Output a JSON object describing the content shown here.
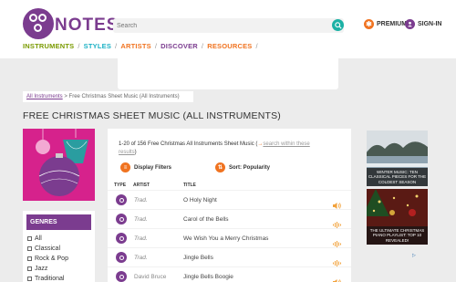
{
  "brand": {
    "name": "NOTES"
  },
  "search": {
    "placeholder": "Search"
  },
  "header": {
    "premium_label": "PREMIUM",
    "signin_label": "SIGN-IN"
  },
  "nav": {
    "items": [
      {
        "label": "INSTRUMENTS",
        "color": "#7a9a00"
      },
      {
        "label": "STYLES",
        "color": "#1cb1c5"
      },
      {
        "label": "ARTISTS",
        "color": "#f07320"
      },
      {
        "label": "DISCOVER",
        "color": "#7b3c8f"
      },
      {
        "label": "RESOURCES",
        "color": "#f07320"
      }
    ]
  },
  "breadcrumb": {
    "root": "All Instruments",
    "sep": ">",
    "current": "Free Christmas Sheet Music (All Instruments)"
  },
  "page": {
    "title": "FREE CHRISTMAS SHEET MUSIC (ALL INSTRUMENTS)"
  },
  "results": {
    "summary": "1-20 of 156 Free Christmas All Instruments Sheet Music (",
    "arrow": "→",
    "search_link": "search within these results",
    "close": ")"
  },
  "filters": {
    "display_label": "Display Filters",
    "sort_label": "Sort: Popularity"
  },
  "table": {
    "headers": {
      "type": "TYPE",
      "artist": "ARTIST",
      "title": "TITLE"
    },
    "rows": [
      {
        "artist": "Trad.",
        "title": "O Holy Night",
        "audio": "speaker-icon"
      },
      {
        "artist": "Trad.",
        "title": "Carol of the Bells",
        "audio": "waveform-icon"
      },
      {
        "artist": "Trad.",
        "title": "We Wish You a Merry Christmas",
        "audio": "waveform-icon"
      },
      {
        "artist": "Trad.",
        "title": "Jingle Bells",
        "audio": "waveform-icon"
      },
      {
        "artist": "David Bruce",
        "title": "Jingle Bells Boogie",
        "audio": "speaker-icon"
      }
    ]
  },
  "genres": {
    "header": "GENRES",
    "items": [
      "All",
      "Classical",
      "Rock & Pop",
      "Jazz",
      "Traditional"
    ]
  },
  "promos": [
    {
      "caption": "WINTER MUSIC: TEN CLASSICAL PIECES FOR THE COLDEST SEASON"
    },
    {
      "caption": "THE ULTIMATE CHRISTMAS PIANO PLAYLIST: TOP 10 REVEALED!"
    }
  ],
  "colors": {
    "brand": "#7b3c8f",
    "accent": "#f07320",
    "teal": "#1cb1a5",
    "hero_bg": "#d6228c"
  }
}
